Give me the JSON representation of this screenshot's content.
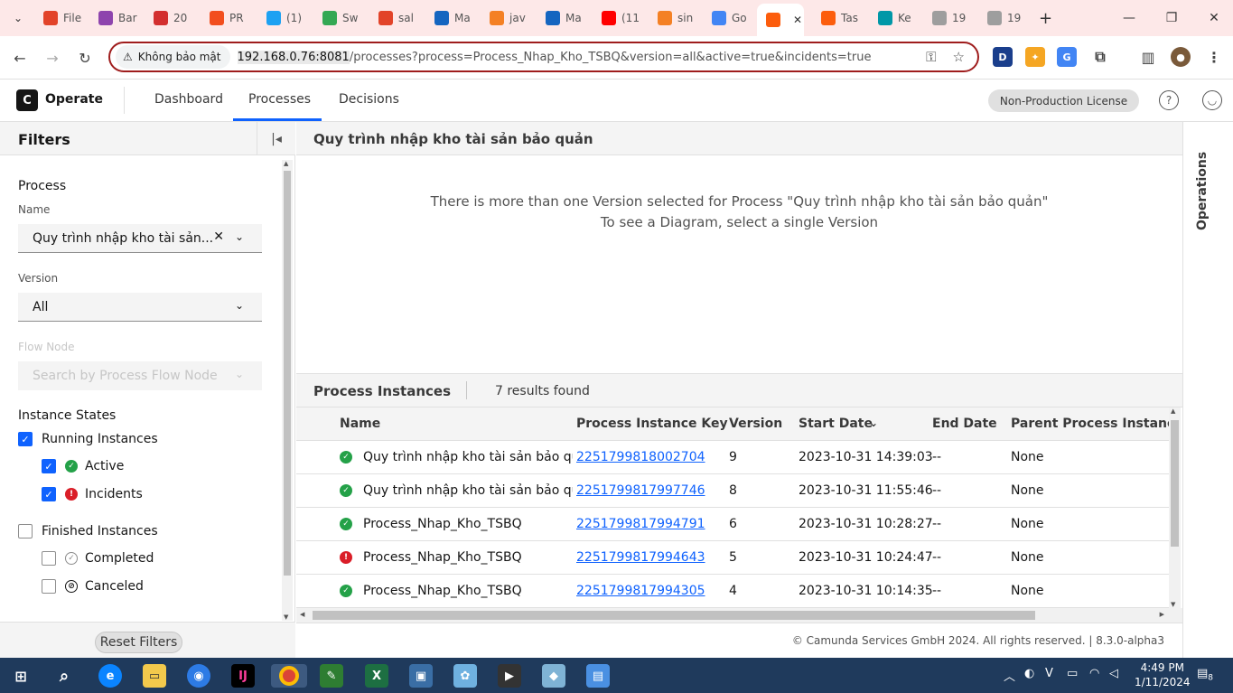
{
  "browser": {
    "tabs": [
      {
        "label": "File",
        "color": "#e24329"
      },
      {
        "label": "Bar",
        "color": "#8e44ad"
      },
      {
        "label": "20",
        "color": "#d32f2f"
      },
      {
        "label": "PR",
        "color": "#f24e1e"
      },
      {
        "label": "(1)",
        "color": "#1da1f2"
      },
      {
        "label": "Sw",
        "color": "#34a853"
      },
      {
        "label": "sal",
        "color": "#e24329"
      },
      {
        "label": "Ma",
        "color": "#1565c0"
      },
      {
        "label": "jav",
        "color": "#f48024"
      },
      {
        "label": "Ma",
        "color": "#1565c0"
      },
      {
        "label": "(11",
        "color": "#ff0000"
      },
      {
        "label": "sin",
        "color": "#f48024"
      },
      {
        "label": "Go",
        "color": "#4285f4"
      },
      {
        "label": "",
        "color": "#fc5d0d"
      },
      {
        "label": "Tas",
        "color": "#fc5d0d"
      },
      {
        "label": "Ke",
        "color": "#0097a7"
      },
      {
        "label": "19",
        "color": "#9e9e9e"
      },
      {
        "label": "19",
        "color": "#9e9e9e"
      }
    ],
    "security_label": "Không bảo mật",
    "url_host": "192.168.0.76:8081",
    "url_rest": "/processes?process=Process_Nhap_Kho_TSBQ&version=all&active=true&incidents=true"
  },
  "app": {
    "logo_letter": "C",
    "name": "Operate",
    "nav": [
      "Dashboard",
      "Processes",
      "Decisions"
    ],
    "license": "Non-Production License"
  },
  "filters": {
    "title": "Filters",
    "process_section": "Process",
    "name_label": "Name",
    "name_value": "Quy trình nhập kho tài sản...",
    "version_label": "Version",
    "version_value": "All",
    "flow_node_label": "Flow Node",
    "flow_node_placeholder": "Search by Process Flow Node",
    "states_section": "Instance States",
    "running": "Running Instances",
    "active": "Active",
    "incidents": "Incidents",
    "finished": "Finished Instances",
    "completed": "Completed",
    "canceled": "Canceled",
    "reset": "Reset Filters"
  },
  "diagram": {
    "title": "Quy trình nhập kho tài sản bảo quản",
    "message_line1": "There is more than one Version selected for Process \"Quy trình nhập kho tài sản bảo quản\"",
    "message_line2": "To see a Diagram, select a single Version"
  },
  "instances": {
    "title": "Process Instances",
    "count": "7 results found",
    "columns": [
      "Name",
      "Process Instance Key",
      "Version",
      "Start Date",
      "End Date",
      "Parent Process Instance K"
    ],
    "rows": [
      {
        "state": "active",
        "name": "Quy trình nhập kho tài sản bảo quản",
        "key": "2251799818002704",
        "version": "9",
        "start": "2023-10-31 14:39:03",
        "end": "--",
        "parent": "None"
      },
      {
        "state": "active",
        "name": "Quy trình nhập kho tài sản bảo quản",
        "key": "2251799817997746",
        "version": "8",
        "start": "2023-10-31 11:55:46",
        "end": "--",
        "parent": "None"
      },
      {
        "state": "active",
        "name": "Process_Nhap_Kho_TSBQ",
        "key": "2251799817994791",
        "version": "6",
        "start": "2023-10-31 10:28:27",
        "end": "--",
        "parent": "None"
      },
      {
        "state": "incident",
        "name": "Process_Nhap_Kho_TSBQ",
        "key": "2251799817994643",
        "version": "5",
        "start": "2023-10-31 10:24:47",
        "end": "--",
        "parent": "None"
      },
      {
        "state": "active",
        "name": "Process_Nhap_Kho_TSBQ",
        "key": "2251799817994305",
        "version": "4",
        "start": "2023-10-31 10:14:35",
        "end": "--",
        "parent": "None"
      }
    ]
  },
  "footer": {
    "copyright": "© Camunda Services GmbH 2024. All rights reserved. | 8.3.0-alpha3"
  },
  "operations": {
    "label": "Operations"
  },
  "taskbar": {
    "time": "4:49 PM",
    "date": "1/11/2024",
    "notifications": "8"
  },
  "colors": {
    "active": "#24a148",
    "incident": "#da1e28",
    "accent": "#0f62fe"
  }
}
